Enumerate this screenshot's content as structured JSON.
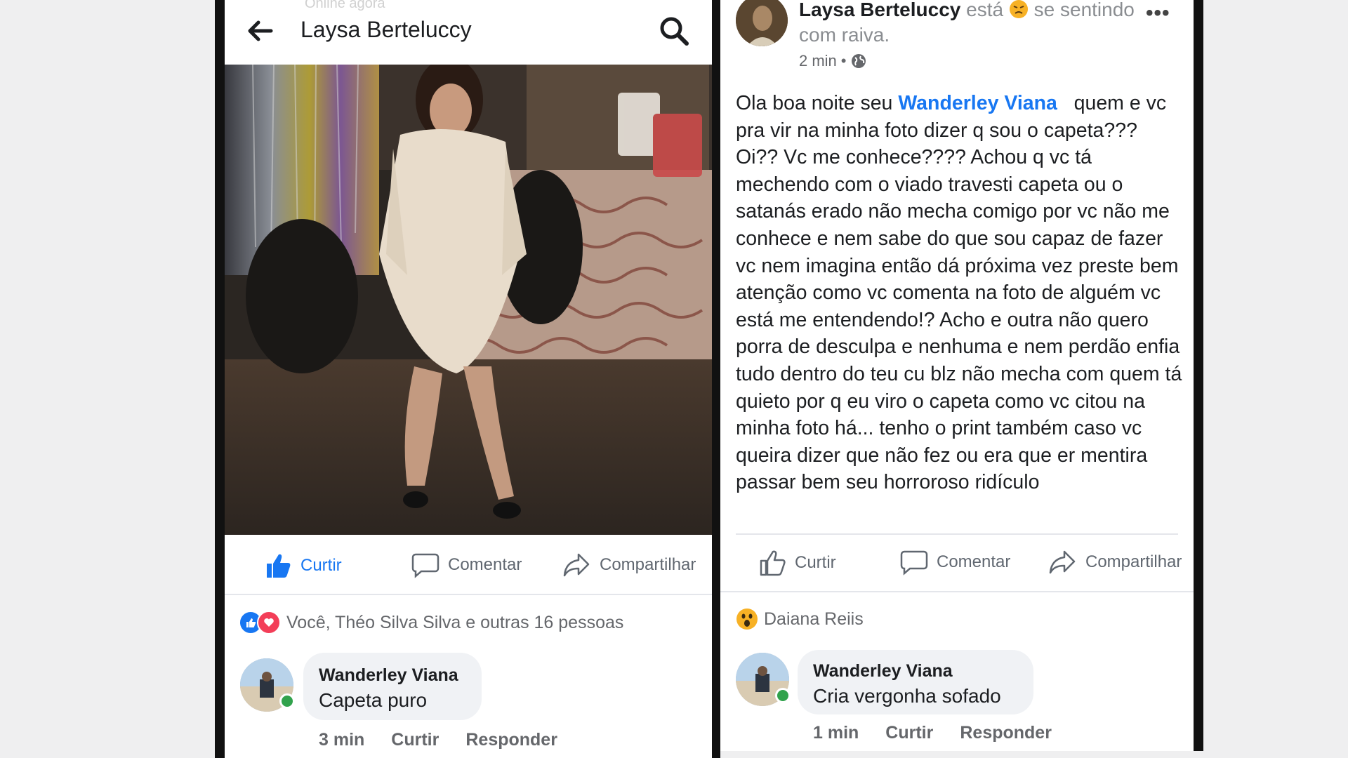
{
  "left": {
    "status": "Online agora",
    "header_title": "Laysa Berteluccy",
    "actions": {
      "like": "Curtir",
      "comment": "Comentar",
      "share": "Compartilhar"
    },
    "reactions_text": "Você, Théo Silva Silva e outras 16 pessoas",
    "comment": {
      "name": "Wanderley Viana",
      "text": "Capeta puro",
      "time": "3 min",
      "like": "Curtir",
      "reply": "Responder"
    }
  },
  "right": {
    "author": "Laysa Berteluccy",
    "feeling_pre": "está",
    "feeling_post": "se sentindo com raiva.",
    "time": "2 min",
    "more": "•••",
    "body_greeting": "Ola boa noite seu",
    "mention": "Wanderley Viana",
    "body_text": "quem e vc pra vir na minha foto dizer q sou o capeta??? Oi?? Vc me conhece???? Achou q vc tá mechendo com o viado travesti capeta ou o satanás erado não mecha comigo por vc não me conhece e nem sabe do que sou capaz de fazer vc nem imagina então dá próxima vez preste bem atenção como vc comenta na foto de alguém vc está me entendendo!? Acho e outra não quero porra de desculpa e nenhuma e nem perdão enfia tudo dentro do teu cu blz não mecha com quem tá quieto por q eu viro o capeta como vc citou na minha foto há... tenho o print também caso vc queira dizer que não fez ou era que er  mentira passar bem seu horroroso ridículo",
    "actions": {
      "like": "Curtir",
      "comment": "Comentar",
      "share": "Compartilhar"
    },
    "reaction_name": "Daiana Reiis",
    "comment": {
      "name": "Wanderley Viana",
      "text": "Cria vergonha sofado",
      "time": "1 min",
      "like": "Curtir",
      "reply": "Responder"
    }
  },
  "colors": {
    "facebook_blue": "#1877f2",
    "love_red": "#f33e58",
    "online_green": "#31a24c"
  }
}
